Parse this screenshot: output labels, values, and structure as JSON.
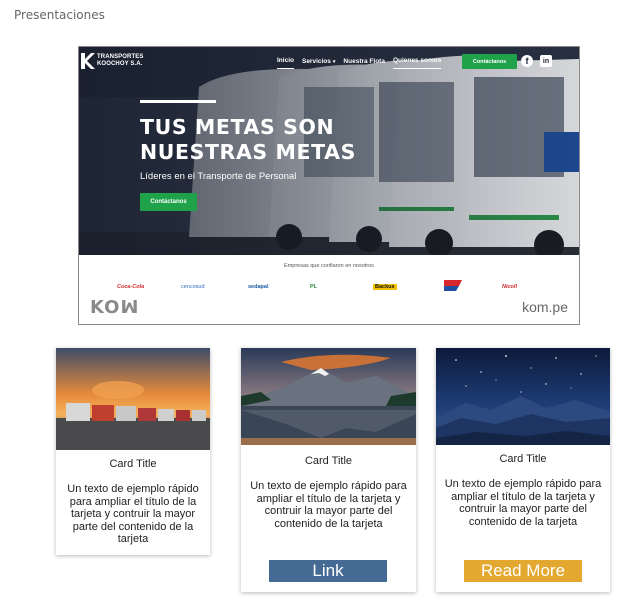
{
  "page": {
    "heading": "Presentaciones"
  },
  "preview": {
    "logo": {
      "line1": "TRANSPORTES",
      "line2": "KOOCHOY S.A."
    },
    "nav": [
      {
        "label": "Inicio"
      },
      {
        "label": "Servicios"
      },
      {
        "label": "Nuestra Flota"
      },
      {
        "label": "Quienes somos"
      }
    ],
    "nav_caret": "▾",
    "nav_cta": "Contáctanos",
    "social": {
      "facebook": "f",
      "linkedin": "in"
    },
    "hero": {
      "title": "TUS METAS SON NUESTRAS METAS",
      "subtitle": "Líderes en el Transporte de Personal",
      "cta": "Contáctanos",
      "bus_badge": "K"
    },
    "clients": {
      "caption": "Empresas que confiaron en nosotros",
      "logos": [
        "Coca-Cola",
        "cencosud",
        "sedapal",
        "PL",
        "Backus",
        "",
        "Nicoll"
      ]
    },
    "footer": {
      "brand": "KOꟽ",
      "url": "kom.pe"
    }
  },
  "cards": [
    {
      "title": "Card Title",
      "text": "Un texto de ejemplo rápido para ampliar el título de la tarjeta y contruir la mayor parte del contenido de la tarjeta",
      "button": ""
    },
    {
      "title": "Card Title",
      "text": "Un texto de ejemplo rápido para ampliar el título de la tarjeta y contruir la mayor parte del contenido de la tarjeta",
      "button": "Link"
    },
    {
      "title": "Card Title",
      "text": "Un texto de ejemplo rápido para ampliar el título de la tarjeta y contruir la mayor parte del contenido de la tarjeta",
      "button": "Read More"
    }
  ],
  "colors": {
    "cta_green": "#1fa24a",
    "link_button": "#456b94",
    "read_more_button": "#e3a830"
  }
}
